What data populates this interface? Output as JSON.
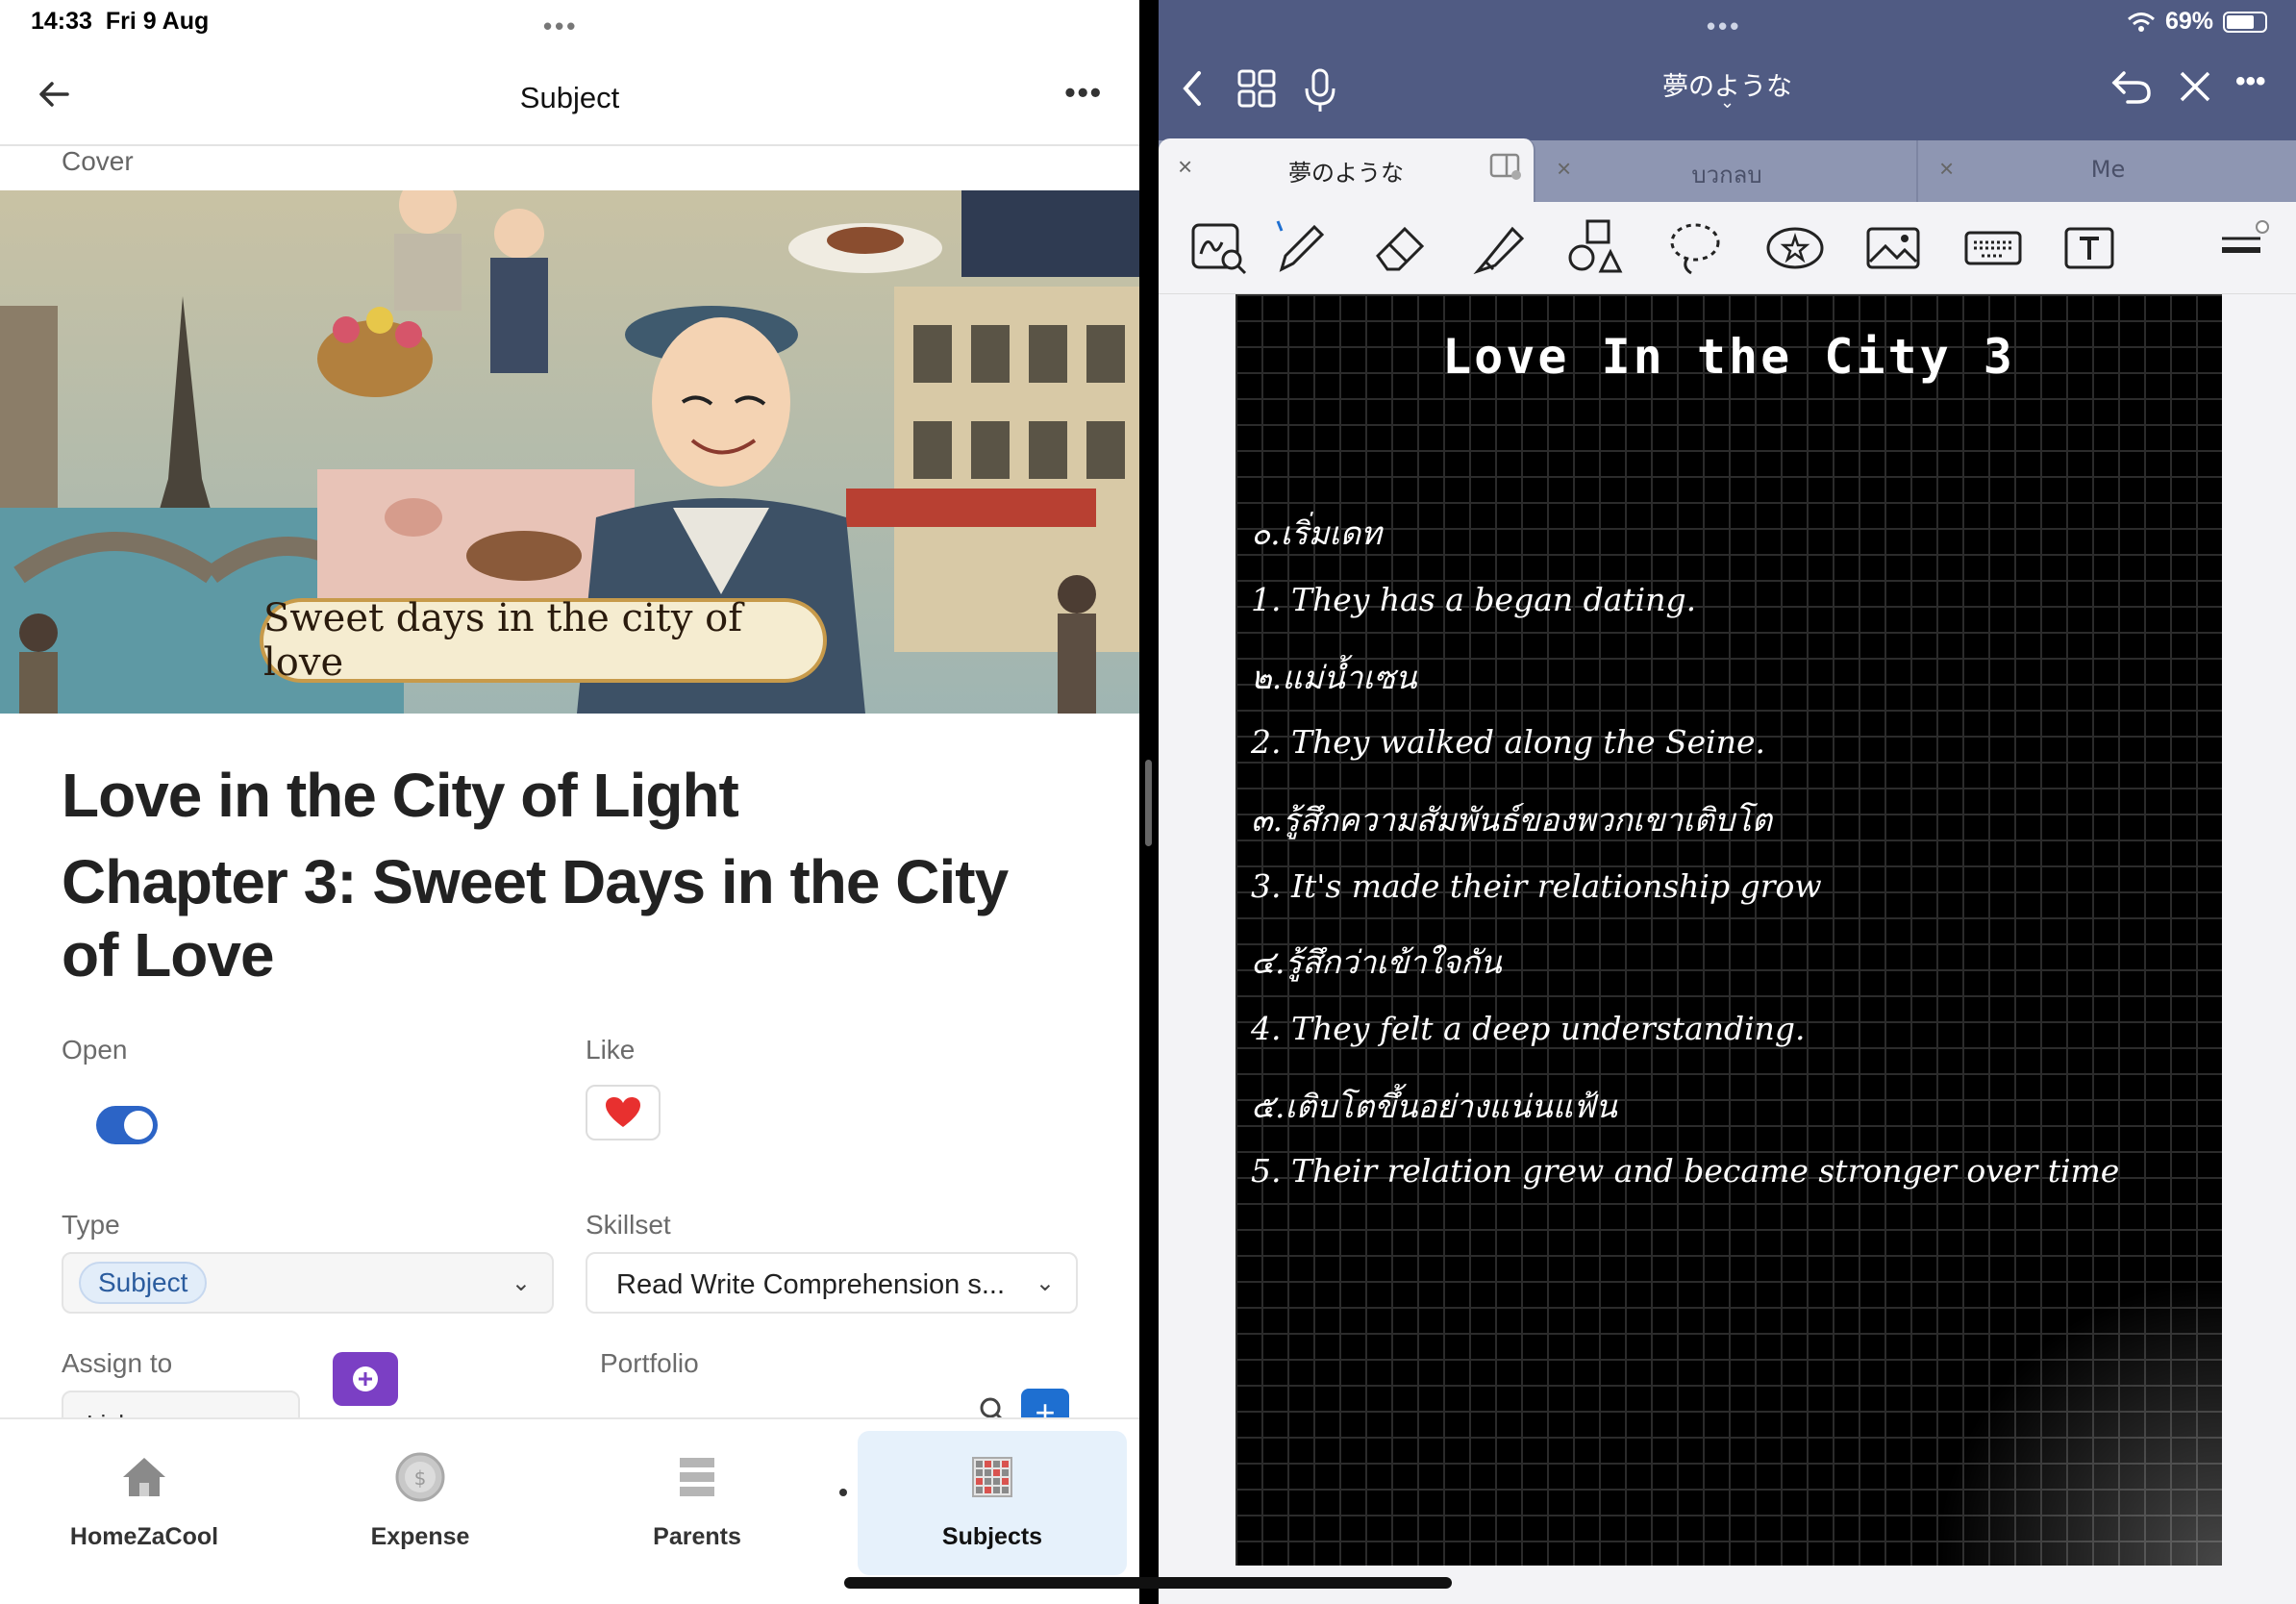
{
  "status": {
    "time": "14:33",
    "date": "Fri 9 Aug",
    "battery": "69%"
  },
  "left": {
    "nav_title": "Subject",
    "cover_label": "Cover",
    "cover_banner": "Sweet days in the city of love",
    "title_lines": [
      "Love in the City of Light",
      "Chapter 3: Sweet Days in the City",
      "of Love"
    ],
    "open_label": "Open",
    "open_value": true,
    "like_label": "Like",
    "type_label": "Type",
    "type_value": "Subject",
    "skillset_label": "Skillset",
    "skillset_value": "Read Write Comprehension s...",
    "assign_label": "Assign to",
    "assign_chip": "Lisha",
    "portfolio_label": "Portfolio",
    "tabs": [
      {
        "label": "HomeZaCool",
        "icon": "home-icon"
      },
      {
        "label": "Expense",
        "icon": "coin-icon"
      },
      {
        "label": "Parents",
        "icon": "list-icon"
      },
      {
        "label": "Subjects",
        "icon": "grid-icon",
        "active": true
      }
    ]
  },
  "right": {
    "doc_title": "夢のような",
    "doc_tabs": [
      {
        "label": "夢のような",
        "active": true
      },
      {
        "label": "บวกลบ"
      },
      {
        "label": "Me"
      }
    ],
    "tools": [
      "handwriting-search-icon",
      "pen-icon",
      "eraser-icon",
      "highlighter-icon",
      "shapes-icon",
      "lasso-icon",
      "sticker-icon",
      "image-icon",
      "keyboard-icon",
      "text-box-icon"
    ],
    "note": {
      "title": "Love In the City 3",
      "lines": [
        "๐.เริ่มเดท",
        "1. They  has  a  began dating.",
        "๒.แม่น้ำเซน",
        "2. They walked along the Seine.",
        "๓.รู้สึกความสัมพันธ์ของพวกเขาเติบโต",
        "3. It's made their relationship grow",
        "๔.รู้สึกว่าเข้าใจกัน",
        "4. They  felt a  deep  understanding.",
        "๕.เติบโตขึ้นอย่างแน่นแฟ้น",
        "5. Their relation grew and became stronger over time"
      ]
    }
  },
  "colors": {
    "accent_blue": "#2c64c6",
    "header_navy": "#505b83",
    "purple": "#7b3fc4",
    "heart": "#e8302f"
  }
}
